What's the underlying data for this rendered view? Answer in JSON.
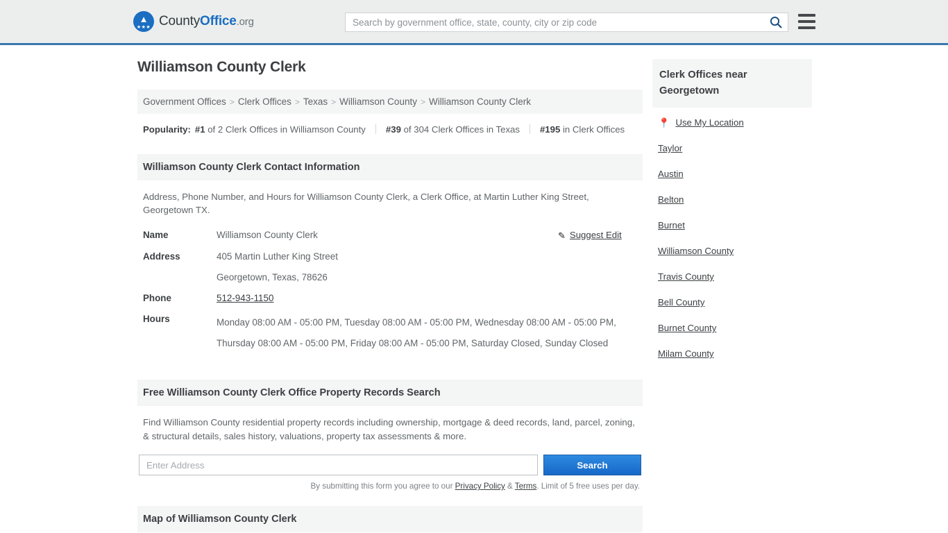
{
  "header": {
    "logo": {
      "part1": "County",
      "part2": "Office",
      "part3": ".org",
      "icon": "eagle-seal-icon"
    },
    "search": {
      "placeholder": "Search by government office, state, county, city or zip code",
      "value": "",
      "icon": "search-icon"
    },
    "menu_icon": "hamburger-menu-icon",
    "accent_color": "#1b6ec2",
    "border_color": "#3a77ae",
    "bg_color": "#eceeed"
  },
  "main": {
    "title": "Williamson County Clerk",
    "breadcrumb": [
      "Government Offices",
      "Clerk Offices",
      "Texas",
      "Williamson County",
      "Williamson County Clerk"
    ],
    "breadcrumb_separator": ">",
    "popularity": {
      "label": "Popularity:",
      "items": [
        {
          "rank": "#1",
          "text": "of 2 Clerk Offices in Williamson County"
        },
        {
          "rank": "#39",
          "text": "of 304 Clerk Offices in Texas"
        },
        {
          "rank": "#195",
          "text": "in Clerk Offices"
        }
      ]
    },
    "contact": {
      "heading": "Williamson County Clerk Contact Information",
      "description": "Address, Phone Number, and Hours for Williamson County Clerk, a Clerk Office, at Martin Luther King Street, Georgetown TX.",
      "suggest_edit": "Suggest Edit",
      "suggest_edit_icon": "pencil-edit-icon",
      "rows": {
        "name_label": "Name",
        "name_value": "Williamson County Clerk",
        "address_label": "Address",
        "address_line1": "405 Martin Luther King Street",
        "address_line2": "Georgetown, Texas, 78626",
        "phone_label": "Phone",
        "phone_value": "512-943-1150",
        "hours_label": "Hours",
        "hours_value": "Monday 08:00 AM - 05:00 PM, Tuesday 08:00 AM - 05:00 PM, Wednesday 08:00 AM - 05:00 PM, Thursday 08:00 AM - 05:00 PM, Friday 08:00 AM - 05:00 PM, Saturday Closed, Sunday Closed"
      }
    },
    "property_search": {
      "heading": "Free Williamson County Clerk Office Property Records Search",
      "description": "Find Williamson County residential property records including ownership, mortgage & deed records, land, parcel, zoning, & structural details, sales history, valuations, property tax assessments & more.",
      "input_placeholder": "Enter Address",
      "input_value": "",
      "button_label": "Search",
      "button_color": "#1668c8",
      "note_prefix": "By submitting this form you agree to our ",
      "note_privacy": "Privacy Policy",
      "note_amp": " & ",
      "note_terms": "Terms",
      "note_suffix": ". Limit of 5 free uses per day."
    },
    "partial_section_heading": "Map of Williamson County Clerk"
  },
  "sidebar": {
    "heading": "Clerk Offices near Georgetown",
    "use_my_location": {
      "label": "Use My Location",
      "icon": "map-pin-icon"
    },
    "links": [
      "Taylor",
      "Austin",
      "Belton",
      "Burnet",
      "Williamson County",
      "Travis County",
      "Bell County",
      "Burnet County",
      "Milam County"
    ]
  }
}
